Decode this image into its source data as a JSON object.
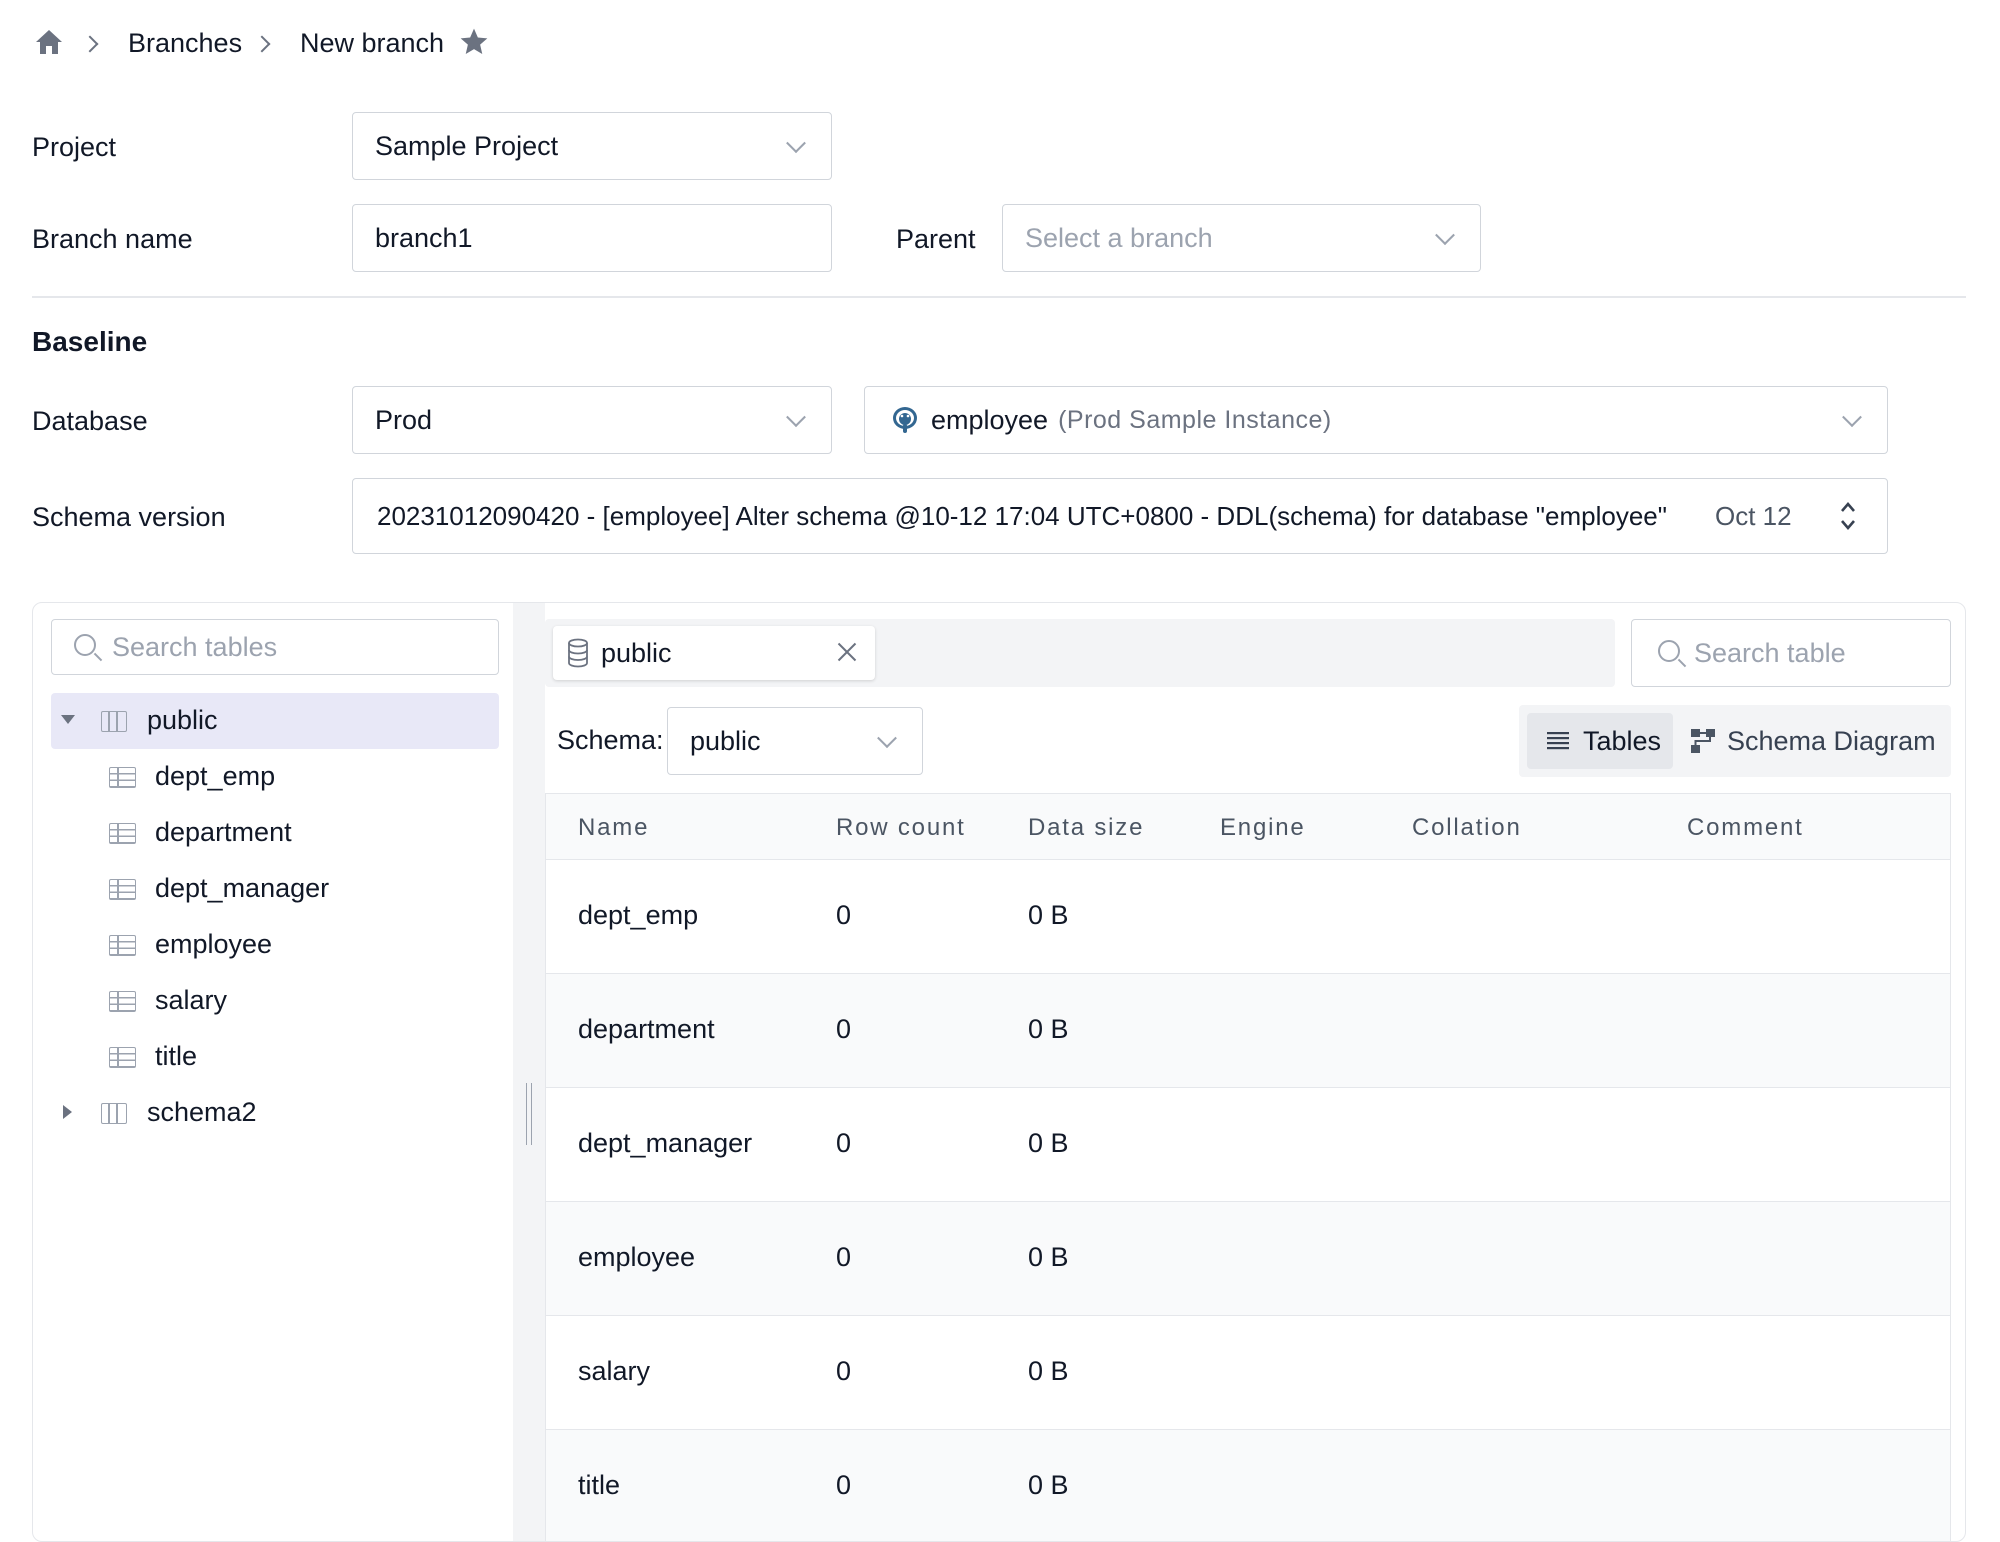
{
  "breadcrumb": {
    "items": [
      "Branches",
      "New branch"
    ]
  },
  "form": {
    "project_label": "Project",
    "project_value": "Sample Project",
    "branch_name_label": "Branch name",
    "branch_name_value": "branch1",
    "parent_label": "Parent",
    "parent_placeholder": "Select a branch",
    "baseline_heading": "Baseline",
    "database_label": "Database",
    "environment_value": "Prod",
    "database_name": "employee",
    "database_instance": "(Prod Sample Instance)",
    "schema_version_label": "Schema version",
    "schema_version_value": "20231012090420 - [employee] Alter schema @10-12 17:04 UTC+0800 - DDL(schema) for database \"employee\"",
    "schema_version_date": "Oct 12"
  },
  "tree": {
    "search_placeholder": "Search tables",
    "schemas": [
      {
        "name": "public",
        "expanded": true,
        "selected": true,
        "tables": [
          "dept_emp",
          "department",
          "dept_manager",
          "employee",
          "salary",
          "title"
        ]
      },
      {
        "name": "schema2",
        "expanded": false,
        "selected": false,
        "tables": []
      }
    ]
  },
  "editor": {
    "tab_label": "public",
    "search_placeholder": "Search table",
    "schema_label": "Schema:",
    "schema_value": "public",
    "view_tables": "Tables",
    "view_diagram": "Schema Diagram",
    "columns": [
      "Name",
      "Row count",
      "Data size",
      "Engine",
      "Collation",
      "Comment"
    ],
    "rows": [
      {
        "name": "dept_emp",
        "row_count": "0",
        "data_size": "0 B"
      },
      {
        "name": "department",
        "row_count": "0",
        "data_size": "0 B"
      },
      {
        "name": "dept_manager",
        "row_count": "0",
        "data_size": "0 B"
      },
      {
        "name": "employee",
        "row_count": "0",
        "data_size": "0 B"
      },
      {
        "name": "salary",
        "row_count": "0",
        "data_size": "0 B"
      },
      {
        "name": "title",
        "row_count": "0",
        "data_size": "0 B"
      }
    ]
  },
  "colors": {
    "selected_row": "#e8e8f7",
    "border": "#d1d5db",
    "placeholder": "#9ca3af",
    "postgres_blue": "#336791"
  }
}
